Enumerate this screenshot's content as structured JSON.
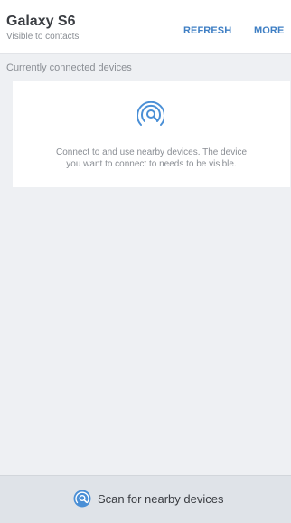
{
  "header": {
    "device_name": "Galaxy S6",
    "visibility": "Visible to contacts",
    "refresh_label": "REFRESH",
    "more_label": "MORE"
  },
  "connected_section": {
    "title": "Currently connected devices",
    "icon": "nearby-device-scan-icon",
    "empty_message_line1": "Connect to and use nearby devices. The device",
    "empty_message_line2": "you want to connect to needs to be visible."
  },
  "bottom_bar": {
    "icon": "nearby-device-scan-icon",
    "scan_label": "Scan for nearby devices"
  },
  "colors": {
    "accent": "#3f7fc4",
    "icon_blue": "#4a8fd6",
    "background": "#eef0f3",
    "bottom_bar": "#dfe3e8"
  }
}
